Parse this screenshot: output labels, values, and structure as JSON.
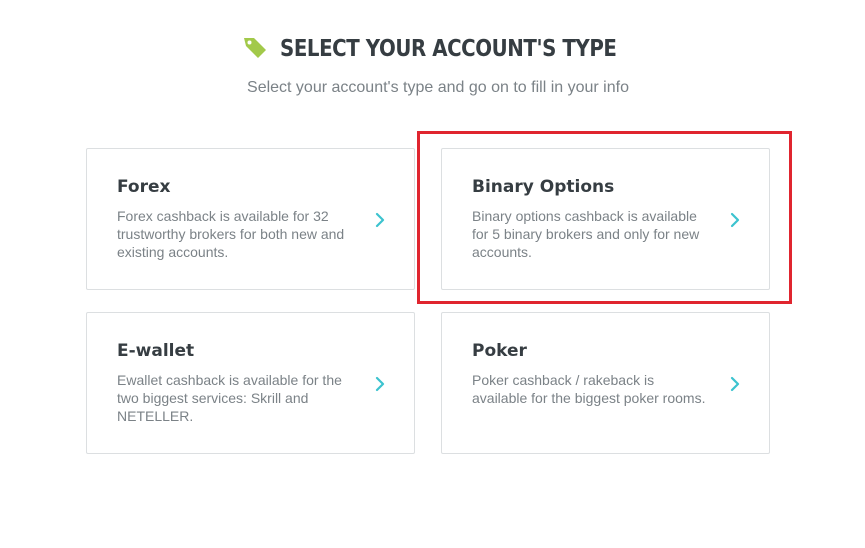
{
  "header": {
    "title": "SELECT YOUR ACCOUNT'S TYPE",
    "subtitle": "Select your account's type and go on to fill in your info",
    "icon": "tag-icon",
    "icon_color": "#a2c94a"
  },
  "cards": [
    {
      "title": "Forex",
      "description": "Forex cashback is available for 32 trustworthy brokers for both new and existing accounts.",
      "icon": "chevron-right-icon"
    },
    {
      "title": "Binary Options",
      "description": "Binary options cashback is available for 5 binary brokers and only for new accounts.",
      "icon": "chevron-right-icon",
      "highlighted": true
    },
    {
      "title": "E-wallet",
      "description": "Ewallet cashback is available for the two biggest services: Skrill and NETELLER.",
      "icon": "chevron-right-icon"
    },
    {
      "title": "Poker",
      "description": "Poker cashback / rakeback is available for the biggest poker rooms.",
      "icon": "chevron-right-icon"
    }
  ],
  "colors": {
    "chevron": "#3cc3cf",
    "highlight": "#e0252f",
    "card_border": "#dcdfe1",
    "title_text": "#363d42",
    "body_text": "#7b8287"
  }
}
